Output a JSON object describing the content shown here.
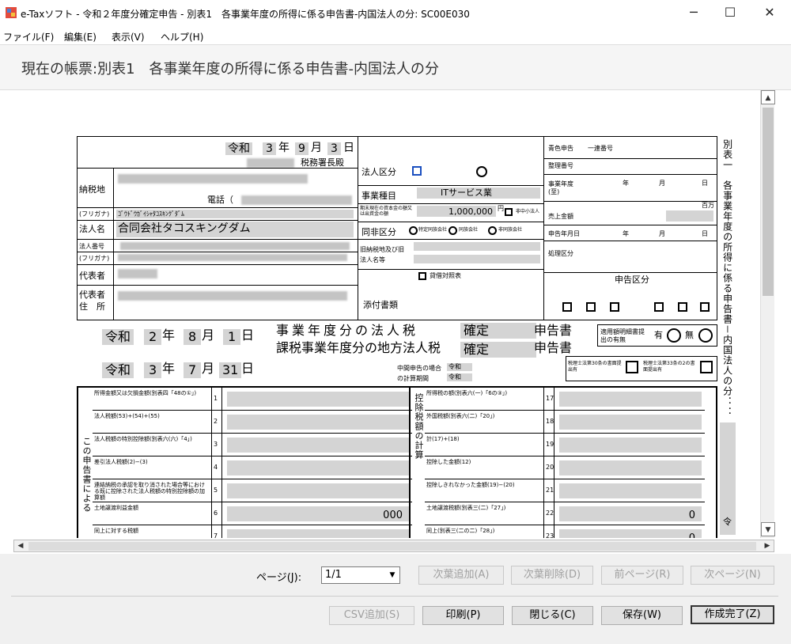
{
  "window": {
    "title": "e-Taxソフト - 令和２年度分確定申告 - 別表1　各事業年度の所得に係る申告書-内国法人の分: SC00E030",
    "minimize": "─",
    "maximize": "☐",
    "close": "✕"
  },
  "menu": [
    "ファイル(F)",
    "編集(E)",
    "表示(V)",
    "ヘルプ(H)"
  ],
  "header": {
    "current_form": "現在の帳票:別表1　各事業年度の所得に係る申告書-内国法人の分"
  },
  "form": {
    "era": "令和",
    "nen": "年",
    "tsuki": "月",
    "hi": "日",
    "submit_year": "3",
    "submit_month": "9",
    "submit_day": "3",
    "tax_office_suffix": "税務署長殿",
    "nouzeichi": "納税地",
    "denwa": "電話（",
    "furigana": "(フリガナ)",
    "furigana_value": "ｺﾞｳﾄﾞｳｶﾞｲｼｬﾀｺｽｷﾝｸﾞﾀﾞﾑ",
    "houjinmei": "法人名",
    "houjinmei_value": "合同会社タコスキングダム",
    "houjin_bangou": "法人番号",
    "furigana2": "(フリガナ)",
    "daihyousha": "代表者",
    "daihyousha_address": "代表者\n住　所",
    "houjin_kubun": "法人区分",
    "jigyou_shumoku": "事業種目",
    "jigyou_shumoku_value": "ITサービス業",
    "capital_label": "期末現在の資本金の額又は出資金の額",
    "capital_value": "1,000,000",
    "yen": "円",
    "hidouzoku": "非中小法人",
    "douhi_kubun": "同非区分",
    "douhi_opt1": "特定同族会社",
    "douhi_opt2": "同族会社",
    "douhi_opt3": "非同族会社",
    "kyuu_nouzei": "旧納税地及び旧法人名等",
    "tenpu": "添付書類",
    "tenpu_value": "貸借対照表",
    "shinkoku": "青色申告",
    "shinkoku_value": "一連番号",
    "seiri_bangou": "整理番号",
    "jigyou_nendo": "事業年度(至)",
    "uriage": "売上金額",
    "hyakuman": "百万",
    "shinkoku_nengappi": "申告年月日",
    "shori": "処理区分",
    "shinkokukubun": "申告区分",
    "nendo_era": "令和",
    "start_year": "2",
    "start_month": "8",
    "start_day": "1",
    "end_year": "3",
    "end_month": "7",
    "end_day": "31",
    "houjinzei_title": "事業年度分の法人税",
    "chihou_title": "課税事業年度分の地方法人税",
    "kakutei": "確定",
    "shinkokusho": "申告書",
    "chuukan": "中間申告の場合の計算期間",
    "chuukan_era": "令和",
    "tekiyou": "適用額明細書提出の有無",
    "ari": "有",
    "nashi": "無",
    "zeirishi30": "税理士法第30条の書面提出有",
    "zeirishi33": "税理士法第33条の2の書面提出有",
    "side_title": "別表一　各事業年度の所得に係る申告書－内国法人の分：：",
    "side_bottom": "令",
    "rows_left": [
      {
        "no": "1",
        "label": "所得金額又は欠損金額(別表四「48の①」)",
        "value": ""
      },
      {
        "no": "2",
        "label": "法人税額(53)+(54)+(55)",
        "value": ""
      },
      {
        "no": "3",
        "label": "法人税額の特別控除額(別表六(六)「4」)",
        "value": ""
      },
      {
        "no": "4",
        "label": "差引法人税額(2)−(3)",
        "value": ""
      },
      {
        "no": "5",
        "label": "連結納税の承認を取り消された場合等における既に控除された法人税額の特別控除額の加算額",
        "value": ""
      },
      {
        "no": "6",
        "label": "土地譲渡利益金額",
        "value": "000"
      },
      {
        "no": "7",
        "label": "同上に対する税額",
        "value": ""
      }
    ],
    "rows_right": [
      {
        "no": "17",
        "label": "所得税の額(別表六(一)「6の③」)",
        "value": ""
      },
      {
        "no": "18",
        "label": "外国税額(別表六(二)「20」)",
        "value": ""
      },
      {
        "no": "19",
        "label": "計(17)+(18)",
        "value": ""
      },
      {
        "no": "20",
        "label": "控除した金額(12)",
        "value": ""
      },
      {
        "no": "21",
        "label": "控除しきれなかった金額(19)−(20)",
        "value": ""
      },
      {
        "no": "22",
        "label": "土地譲渡税額(別表三(二)「27」)",
        "value": "0"
      },
      {
        "no": "23",
        "label": "同上(別表三(二の二)「28」)",
        "value": "0"
      }
    ],
    "koujo": "控除税額の計算",
    "kono": "この申告書による"
  },
  "toolbar": {
    "page_label": "ページ(J):",
    "page_value": "1/1",
    "add_page": "次葉追加(A)",
    "del_page": "次葉削除(D)",
    "prev": "前ページ(R)",
    "next": "次ページ(N)",
    "csv": "CSV追加(S)",
    "print": "印刷(P)",
    "close": "閉じる(C)",
    "save": "保存(W)",
    "done": "作成完了(Z)"
  }
}
